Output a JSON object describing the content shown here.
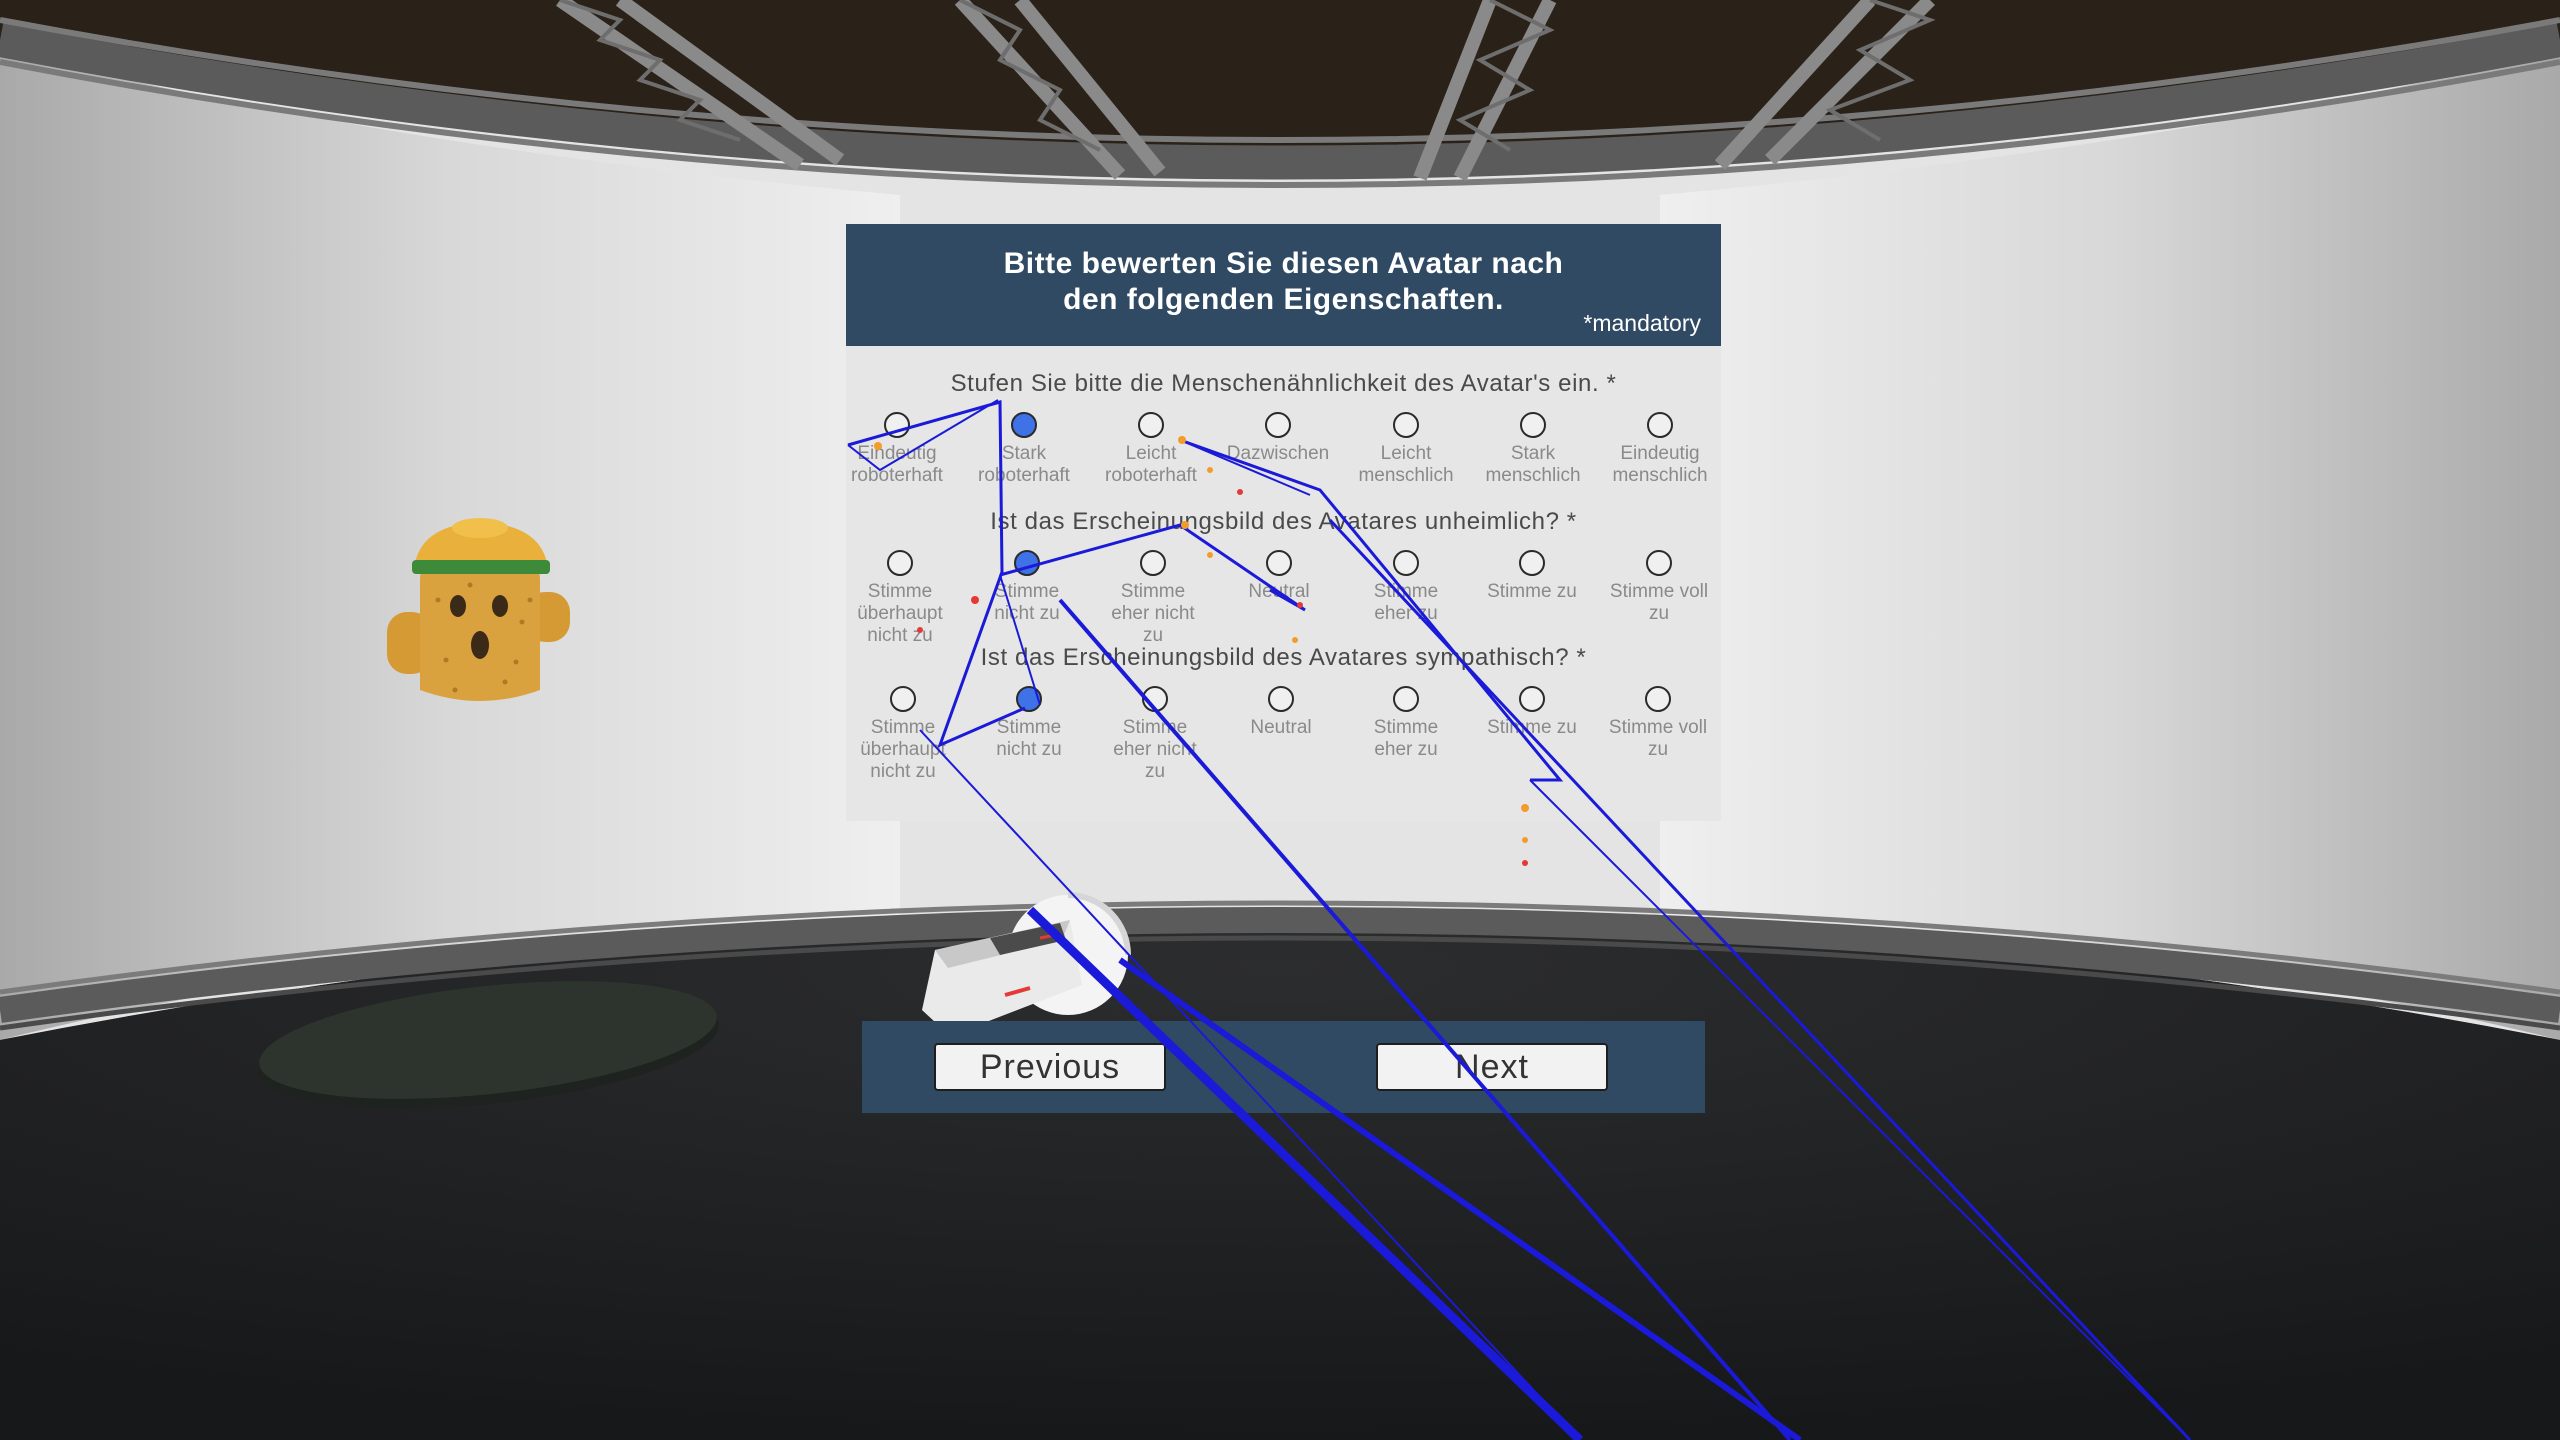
{
  "header": {
    "title_line1": "Bitte bewerten Sie diesen Avatar nach",
    "title_line2": "den folgenden Eigenschaften.",
    "mandatory": "*mandatory"
  },
  "questions": [
    {
      "text": "Stufen Sie bitte die Menschenähnlichkeit des Avatar's ein.   *",
      "selected": 1,
      "options": [
        {
          "l1": "Eindeutig",
          "l2": "roboterhaft",
          "l3": ""
        },
        {
          "l1": "Stark",
          "l2": "roboterhaft",
          "l3": ""
        },
        {
          "l1": "Leicht",
          "l2": "roboterhaft",
          "l3": ""
        },
        {
          "l1": "Dazwischen",
          "l2": "",
          "l3": ""
        },
        {
          "l1": "Leicht",
          "l2": "menschlich",
          "l3": ""
        },
        {
          "l1": "Stark",
          "l2": "menschlich",
          "l3": ""
        },
        {
          "l1": "Eindeutig",
          "l2": "menschlich",
          "l3": ""
        }
      ]
    },
    {
      "text": "Ist das Erscheinungsbild des Avatares unheimlich? *",
      "selected": 1,
      "options": [
        {
          "l1": "Stimme",
          "l2": "überhaupt",
          "l3": "nicht zu"
        },
        {
          "l1": "Stimme",
          "l2": "nicht zu",
          "l3": ""
        },
        {
          "l1": "Stimme",
          "l2": "eher nicht",
          "l3": "zu"
        },
        {
          "l1": "Neutral",
          "l2": "",
          "l3": ""
        },
        {
          "l1": "Stimme",
          "l2": "eher zu",
          "l3": ""
        },
        {
          "l1": "Stimme zu",
          "l2": "",
          "l3": ""
        },
        {
          "l1": "Stimme voll",
          "l2": "zu",
          "l3": ""
        }
      ]
    },
    {
      "text": "Ist das Erscheinungsbild des Avatares sympathisch? *",
      "selected": 1,
      "options": [
        {
          "l1": "Stimme",
          "l2": "überhaupt",
          "l3": "nicht zu"
        },
        {
          "l1": "Stimme",
          "l2": "nicht zu",
          "l3": ""
        },
        {
          "l1": "Stimme",
          "l2": "eher nicht",
          "l3": "zu"
        },
        {
          "l1": "Neutral",
          "l2": "",
          "l3": ""
        },
        {
          "l1": "Stimme",
          "l2": "eher zu",
          "l3": ""
        },
        {
          "l1": "Stimme zu",
          "l2": "",
          "l3": ""
        },
        {
          "l1": "Stimme voll",
          "l2": "zu",
          "l3": ""
        }
      ]
    }
  ],
  "footer": {
    "previous_label": "Previous",
    "next_label": "Next"
  },
  "colors": {
    "panel_header": "#2f4a62",
    "panel_body": "#e6e6e6",
    "radio_selected": "#3f72e6",
    "pointer_ray": "#1a1ad8"
  },
  "scene": {
    "avatar": "cactus-avatar-with-hard-hat",
    "controller": "vr-controller",
    "pedestal": "dark-oval-pedestal"
  }
}
